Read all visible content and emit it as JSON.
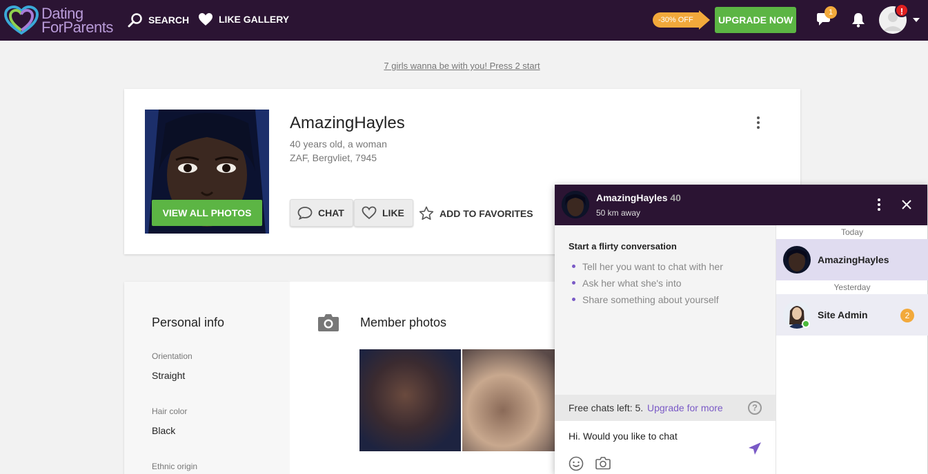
{
  "brand": {
    "line1": "Dating",
    "line2": "ForParents"
  },
  "nav": {
    "search": "SEARCH",
    "like_gallery": "LIKE GALLERY"
  },
  "header": {
    "discount": "-30% OFF",
    "upgrade": "UPGRADE NOW",
    "messages_count": "1",
    "alert": "!"
  },
  "promo": "7 girls wanna be with you! Press 2 start",
  "profile": {
    "name": "AmazingHayles",
    "age_gender": "40 years old, a woman",
    "location": "ZAF, Bergvliet, 7945",
    "view_photos": "VIEW ALL PHOTOS",
    "chat": "CHAT",
    "like": "LIKE",
    "favorites": "ADD TO FAVORITES"
  },
  "personal_info": {
    "title": "Personal info",
    "fields": [
      {
        "label": "Orientation",
        "value": "Straight"
      },
      {
        "label": "Hair color",
        "value": "Black"
      },
      {
        "label": "Ethnic origin",
        "value": ""
      }
    ]
  },
  "photos": {
    "title": "Member photos"
  },
  "chat": {
    "name": "AmazingHayles",
    "age": "40",
    "distance": "50 km away",
    "conversation_title": "Start a flirty conversation",
    "tips": [
      "Tell her you want to chat with her",
      "Ask her what she's into",
      "Share something about yourself"
    ],
    "free_chats": "Free chats left: 5.",
    "upgrade_link": "Upgrade for more",
    "help": "?",
    "message_value": "Hi. Would you like to chat",
    "today": "Today",
    "yesterday": "Yesterday",
    "conversations": [
      {
        "name": "AmazingHayles"
      },
      {
        "name": "Site Admin",
        "unread": "2"
      }
    ]
  },
  "colors": {
    "header_bg": "#2b1433",
    "accent_green": "#5cb544",
    "accent_orange": "#f2a93b",
    "accent_purple": "#7a5ac6"
  }
}
